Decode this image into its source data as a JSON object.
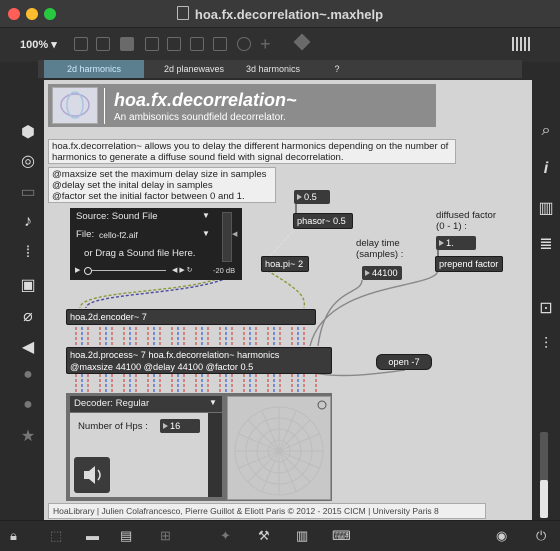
{
  "window": {
    "title": "hoa.fx.decorrelation~.maxhelp",
    "zoom": "100%"
  },
  "tabs": [
    "2d harmonics",
    "2d planewaves",
    "3d harmonics",
    "?"
  ],
  "banner": {
    "title": "hoa.fx.decorrelation~",
    "subtitle": "An ambisonics soundfield decorrelator."
  },
  "description": "hoa.fx.decorrelation~ allows you to delay the different harmonics depending on the number of harmonics to generate a diffuse sound field with signal decorrelation.",
  "attributes": [
    "@maxsize set the maximum delay size in samples",
    "@delay set the inital delay in samples",
    "@factor set the initial factor between 0 and 1."
  ],
  "player": {
    "source_label": "Source: Sound File",
    "file_label": "File:",
    "file_name": "cello-f2.aif",
    "drag_hint": "or Drag a Sound file Here.",
    "gain": "-20 dB"
  },
  "objects": {
    "num_phasor": "0.5",
    "phasor": "phasor~ 0.5",
    "hoa_pi": "hoa.pi~ 2",
    "delay_label": "delay time (samples) :",
    "delay_value": "44100",
    "factor_label": "diffused factor (0 - 1) :",
    "factor_value": "1.",
    "prepend": "prepend factor",
    "encoder": "hoa.2d.encoder~ 7",
    "process_line1": "hoa.2d.process~ 7 hoa.fx.decorrelation~ harmonics",
    "process_line2": "@maxsize 44100 @delay 44100 @factor 0.5",
    "open": "open -7"
  },
  "decoder": {
    "menu_label": "Decoder: Regular",
    "hps_label": "Number of Hps :",
    "hps_value": "16"
  },
  "footer": "HoaLibrary | Julien Colafrancesco, Pierre Guillot & Eliott Paris © 2012 - 2015 CICM | University Paris 8",
  "icons": {
    "left": [
      "package-icon",
      "circle-target-icon",
      "window-icon",
      "music-note-icon",
      "brackets-icon",
      "image-icon",
      "paperclip-icon",
      "plug-icon",
      "info-circle-icon",
      "bold-circle-icon",
      "star-icon"
    ],
    "right": [
      "search-icon",
      "info-icon",
      "columns-icon",
      "list-icon",
      "camera-icon",
      "sliders-icon"
    ],
    "bottom": [
      "lock-icon",
      "presentation-icon",
      "comment-icon",
      "windows-icon",
      "grid-icon",
      "wand-icon",
      "wrench-icon",
      "piano-icon",
      "keyboard-icon",
      "play-circle-icon",
      "power-icon"
    ]
  },
  "colors": {
    "banner": "#8c8c8c",
    "tab_active": "#5b7f8e",
    "object": "#3a3a3a",
    "patcher_bg": "#d4d4d4"
  }
}
